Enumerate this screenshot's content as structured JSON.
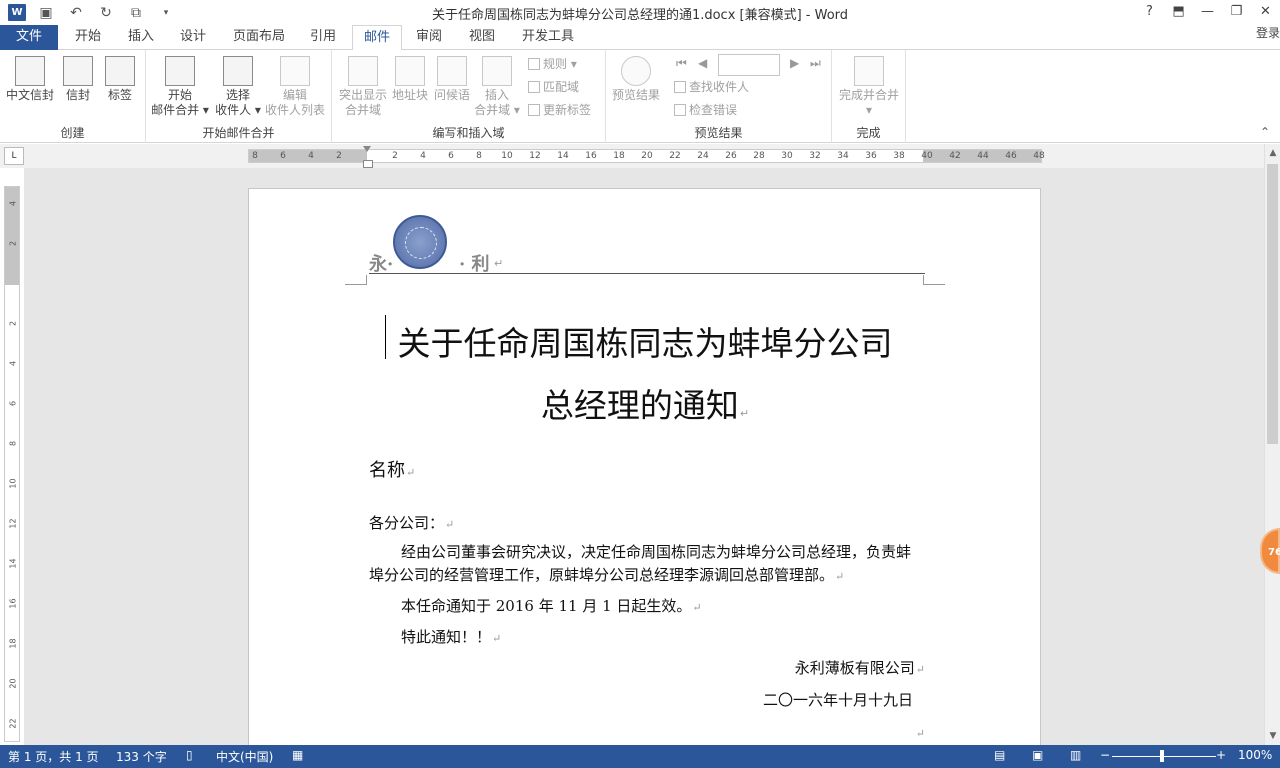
{
  "window": {
    "title": "关于任命周国栋同志为蚌埠分公司总经理的通1.docx [兼容模式] - Word",
    "app_icon": "W",
    "help": "?",
    "login": "登录"
  },
  "tabs": [
    {
      "label": "文件"
    },
    {
      "label": "开始"
    },
    {
      "label": "插入"
    },
    {
      "label": "设计"
    },
    {
      "label": "页面布局"
    },
    {
      "label": "引用"
    },
    {
      "label": "邮件",
      "active": true
    },
    {
      "label": "审阅"
    },
    {
      "label": "视图"
    },
    {
      "label": "开发工具"
    }
  ],
  "ribbon": {
    "create": {
      "label": "创建",
      "envelope_cn": "中文信封",
      "envelope": "信封",
      "labels": "标签"
    },
    "start_merge": {
      "label": "开始邮件合并",
      "start_line1": "开始",
      "start_line2": "邮件合并 ▾",
      "select_line1": "选择",
      "select_line2": "收件人 ▾",
      "edit_line1": "编辑",
      "edit_line2": "收件人列表"
    },
    "write_insert": {
      "label": "编写和插入域",
      "highlight_line1": "突出显示",
      "highlight_line2": "合并域",
      "address": "地址块",
      "greeting": "问候语",
      "insert_line1": "插入",
      "insert_line2": "合并域 ▾",
      "rules": "规则 ▾",
      "match": "匹配域",
      "update": "更新标签"
    },
    "preview": {
      "label": "预览结果",
      "preview_btn": "预览结果",
      "find": "查找收件人",
      "check": "检查错误"
    },
    "finish": {
      "label": "完成",
      "finish_btn": "完成并合并",
      "finish_arrow": "▾"
    }
  },
  "ruler": {
    "h_ticks": [
      "8",
      "6",
      "4",
      "2",
      "",
      "2",
      "4",
      "6",
      "8",
      "10",
      "12",
      "14",
      "16",
      "18",
      "20",
      "22",
      "24",
      "26",
      "28",
      "30",
      "32",
      "34",
      "36",
      "38",
      "40",
      "42",
      "44",
      "46",
      "48"
    ],
    "v_ticks": [
      "4",
      "2",
      "",
      "2",
      "4",
      "6",
      "8",
      "10",
      "12",
      "14",
      "16",
      "18",
      "20",
      "22"
    ]
  },
  "document": {
    "letterhead_left": "永·",
    "letterhead_right": "· 利",
    "title_line1": "关于任命周国栋同志为蚌埠分公司",
    "title_line2": "总经理的通知",
    "name_field": "名称",
    "salutation": "各分公司：",
    "body1": "经由公司董事会研究决议，决定任命周国栋同志为蚌埠分公司总经理，负责蚌埠分公司的经营管理工作，原蚌埠分公司总经理李源调回总部管理部。",
    "body2": "本任命通知于 2016 年 11 月 1 日起生效。",
    "body3": "特此通知！！",
    "company": "永利薄板有限公司",
    "date": "二〇一六年十月十九日",
    "para_mark": "↵"
  },
  "side_badge": "76",
  "status": {
    "page": "第 1 页，共 1 页",
    "words": "133 个字",
    "language": "中文(中国)",
    "zoom": "100%",
    "zoom_minus": "−",
    "zoom_plus": "+"
  },
  "colors": {
    "accent": "#2b579a",
    "badge": "#f08a3e"
  }
}
